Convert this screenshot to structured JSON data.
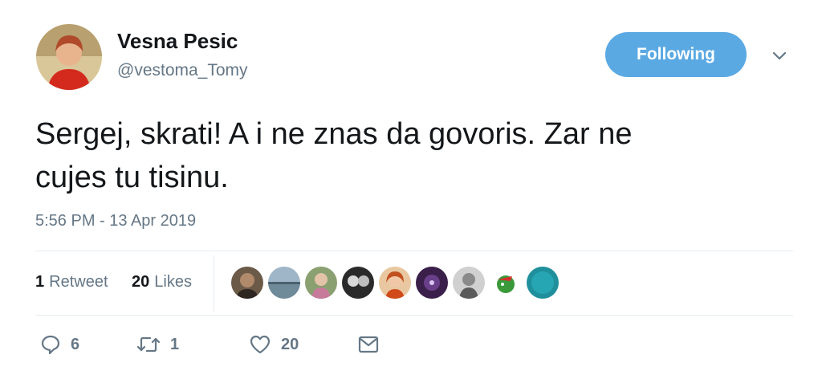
{
  "user": {
    "display_name": "Vesna Pesic",
    "handle": "@vestoma_Tomy"
  },
  "follow_button": {
    "label": "Following"
  },
  "tweet": {
    "text_line1": "Sergej, skrati! A i ne znas da govoris. Zar ne",
    "text_line2": "cujes tu tisinu.",
    "timestamp": "5:56 PM - 13 Apr 2019"
  },
  "stats": {
    "retweets_count": "1",
    "retweets_label": "Retweet",
    "likes_count": "20",
    "likes_label": "Likes"
  },
  "actions": {
    "reply_count": "6",
    "retweet_count": "1",
    "like_count": "20"
  },
  "colors": {
    "follow_button": "#5aa9e3",
    "secondary_text": "#657786",
    "divider": "#e6ecf0"
  },
  "icons": [
    "chevron-down-icon",
    "reply-icon",
    "retweet-icon",
    "heart-icon",
    "message-icon"
  ]
}
